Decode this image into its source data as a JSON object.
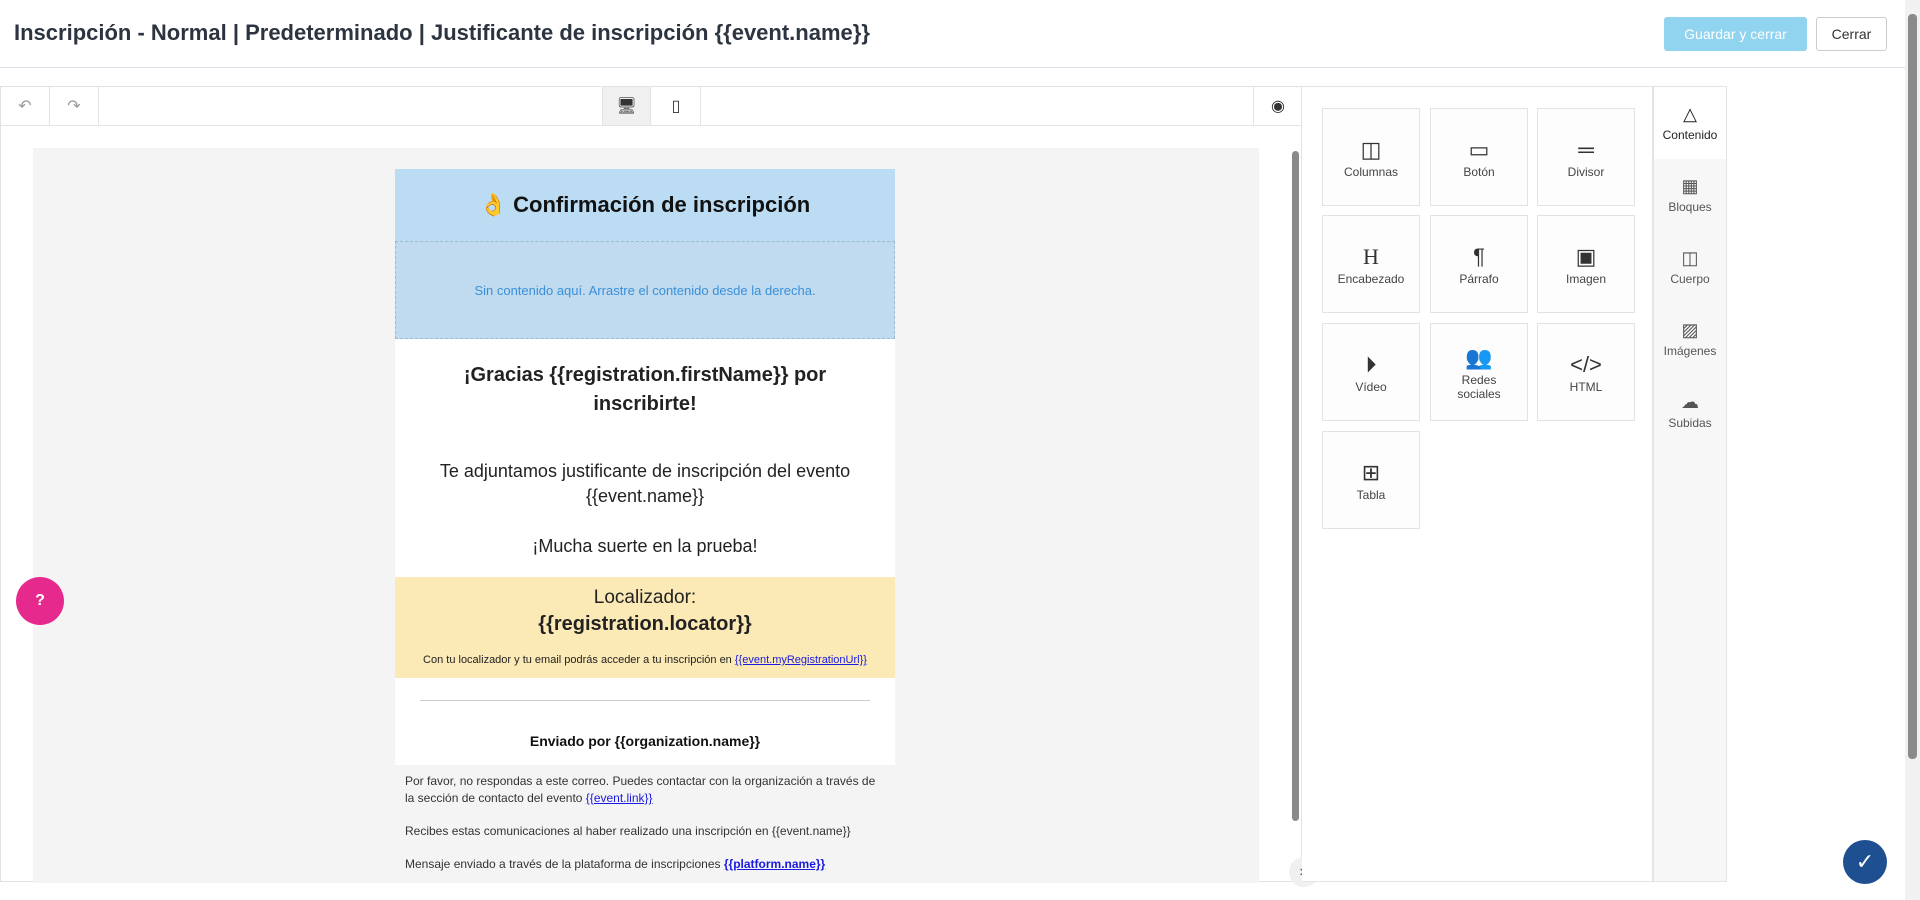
{
  "header": {
    "title": "Inscripción - Normal | Predeterminado | Justificante de inscripción {{event.name}}",
    "save_label": "Guardar y cerrar",
    "close_label": "Cerrar"
  },
  "email": {
    "header_emoji": "👌",
    "header_title": "Confirmación de inscripción",
    "drop_hint": "Sin contenido aquí. Arrastre el contenido desde la derecha.",
    "greeting": "¡Gracias {{registration.firstName}} por inscribirte!",
    "intro": "Te adjuntamos justificante de inscripción del evento {{event.name}}",
    "luck": "¡Mucha suerte en la prueba!",
    "locator_label": "Localizador:",
    "locator_value": "{{registration.locator}}",
    "locator_note": "Con tu localizador y tu email podrás acceder a tu inscripción en",
    "locator_link": "{{event.myRegistrationUrl}}",
    "sent_by": "Enviado por {{organization.name}}",
    "note1": "Por favor, no respondas a este correo. Puedes contactar con la organización a través de la sección de contacto del evento",
    "note1_link": "{{event.link}}",
    "note2": "Recibes estas comunicaciones al haber realizado una inscripción en {{event.name}}",
    "note3": "Mensaje enviado a través de la plataforma de inscripciones",
    "note3_link": "{{platform.name}}"
  },
  "tiles": [
    {
      "label": "Columnas",
      "icon": "columns-icon"
    },
    {
      "label": "Botón",
      "icon": "button-icon"
    },
    {
      "label": "Divisor",
      "icon": "divider-icon"
    },
    {
      "label": "Encabezado",
      "icon": "heading-icon"
    },
    {
      "label": "Párrafo",
      "icon": "paragraph-icon"
    },
    {
      "label": "Imagen",
      "icon": "image-icon"
    },
    {
      "label": "Vídeo",
      "icon": "video-icon"
    },
    {
      "label": "Redes sociales",
      "icon": "social-icon"
    },
    {
      "label": "HTML",
      "icon": "code-icon"
    },
    {
      "label": "Tabla",
      "icon": "table-icon"
    }
  ],
  "rail": [
    {
      "label": "Contenido"
    },
    {
      "label": "Bloques"
    },
    {
      "label": "Cuerpo"
    },
    {
      "label": "Imágenes"
    },
    {
      "label": "Subidas"
    }
  ],
  "help": "?"
}
